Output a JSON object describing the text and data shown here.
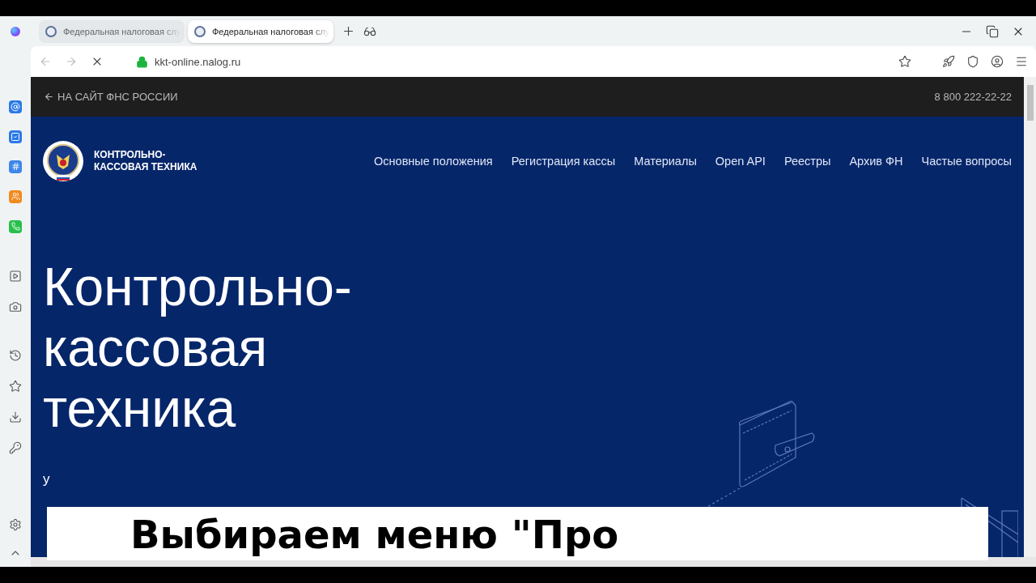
{
  "tabs": [
    {
      "title": "Федеральная налоговая слу",
      "selected": false
    },
    {
      "title": "Федеральная налоговая слу",
      "selected": true
    }
  ],
  "address_bar": {
    "url": "kkt-online.nalog.ru",
    "loading": true
  },
  "page": {
    "back_link": "НА САЙТ ФНС РОССИИ",
    "phone": "8 800 222-22-22",
    "logo_text": [
      "КОНТРОЛЬНО-",
      "КАССОВАЯ ТЕХНИКА"
    ],
    "nav": [
      "Основные положения",
      "Регистрация кассы",
      "Материалы",
      "Open API",
      "Реестры",
      "Архив ФН",
      "Частые вопросы"
    ],
    "hero_title": [
      "Контрольно-",
      "кассовая",
      "техника"
    ],
    "hero_subtitle": [
      "у"
    ]
  },
  "caption": "Выбираем меню \"Про"
}
